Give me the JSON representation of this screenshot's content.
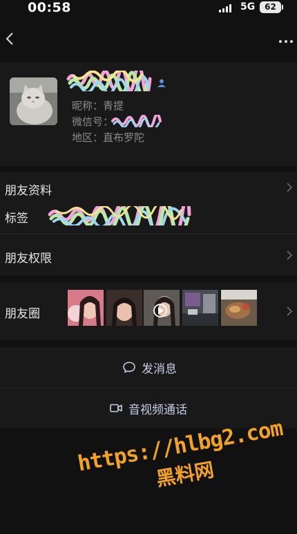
{
  "status_bar": {
    "time": "00:58",
    "network": "5G",
    "battery": "62"
  },
  "profile": {
    "nickname_label": "昵称：",
    "nickname_value": "青提",
    "wechat_id_label": "微信号：",
    "region_label": "地区：",
    "region_value": "直布罗陀"
  },
  "rows": {
    "friend_info": "朋友资料",
    "tags": "标签",
    "permissions": "朋友权限",
    "moments": "朋友圈"
  },
  "actions": {
    "message": "发消息",
    "call": "音视频通话"
  },
  "watermark": {
    "url": "https://hlbg2.com",
    "name": "黑料网"
  },
  "colors": {
    "background": "#111111",
    "cell": "#191919",
    "link": "#c8cbe6",
    "watermark": "#f3a321"
  }
}
